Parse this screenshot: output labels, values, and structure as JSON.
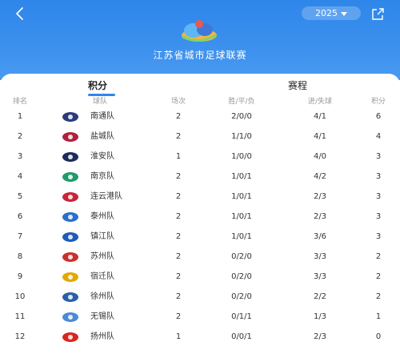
{
  "header": {
    "year_label": "2025",
    "title": "江苏省城市足球联赛"
  },
  "tabs": [
    {
      "label": "积分",
      "active": true
    },
    {
      "label": "赛程",
      "active": false
    }
  ],
  "table": {
    "columns": [
      "排名",
      "球队",
      "场次",
      "胜/平/负",
      "进/失球",
      "积分"
    ],
    "rows": [
      {
        "rank": "1",
        "team": "南通队",
        "played": "2",
        "wdl": "2/0/0",
        "gf_ga": "4/1",
        "pts": "6",
        "color": "#2b3a7a"
      },
      {
        "rank": "2",
        "team": "盐城队",
        "played": "2",
        "wdl": "1/1/0",
        "gf_ga": "4/1",
        "pts": "4",
        "color": "#b0203a"
      },
      {
        "rank": "3",
        "team": "淮安队",
        "played": "1",
        "wdl": "1/0/0",
        "gf_ga": "4/0",
        "pts": "3",
        "color": "#1c2b5c"
      },
      {
        "rank": "4",
        "team": "南京队",
        "played": "2",
        "wdl": "1/0/1",
        "gf_ga": "4/2",
        "pts": "3",
        "color": "#1f9a6a"
      },
      {
        "rank": "5",
        "team": "连云港队",
        "played": "2",
        "wdl": "1/0/1",
        "gf_ga": "2/3",
        "pts": "3",
        "color": "#c8243a"
      },
      {
        "rank": "6",
        "team": "泰州队",
        "played": "2",
        "wdl": "1/0/1",
        "gf_ga": "2/3",
        "pts": "3",
        "color": "#2a6fc9"
      },
      {
        "rank": "7",
        "team": "镇江队",
        "played": "2",
        "wdl": "1/0/1",
        "gf_ga": "3/6",
        "pts": "3",
        "color": "#1e5bb8"
      },
      {
        "rank": "8",
        "team": "苏州队",
        "played": "2",
        "wdl": "0/2/0",
        "gf_ga": "3/3",
        "pts": "2",
        "color": "#c9302c"
      },
      {
        "rank": "9",
        "team": "宿迁队",
        "played": "2",
        "wdl": "0/2/0",
        "gf_ga": "3/3",
        "pts": "2",
        "color": "#e0a800"
      },
      {
        "rank": "10",
        "team": "徐州队",
        "played": "2",
        "wdl": "0/2/0",
        "gf_ga": "2/2",
        "pts": "2",
        "color": "#2a5fa8"
      },
      {
        "rank": "11",
        "team": "无锡队",
        "played": "2",
        "wdl": "0/1/1",
        "gf_ga": "1/3",
        "pts": "1",
        "color": "#4a8ad8"
      },
      {
        "rank": "12",
        "team": "扬州队",
        "played": "1",
        "wdl": "0/0/1",
        "gf_ga": "2/3",
        "pts": "0",
        "color": "#d8261f"
      }
    ]
  },
  "colors": {
    "accent": "#2f86ea",
    "header_bg": "#3b90ee"
  },
  "icons": {
    "back": "back-chevron-icon",
    "share": "share-icon",
    "dropdown": "dropdown-caret-icon"
  }
}
